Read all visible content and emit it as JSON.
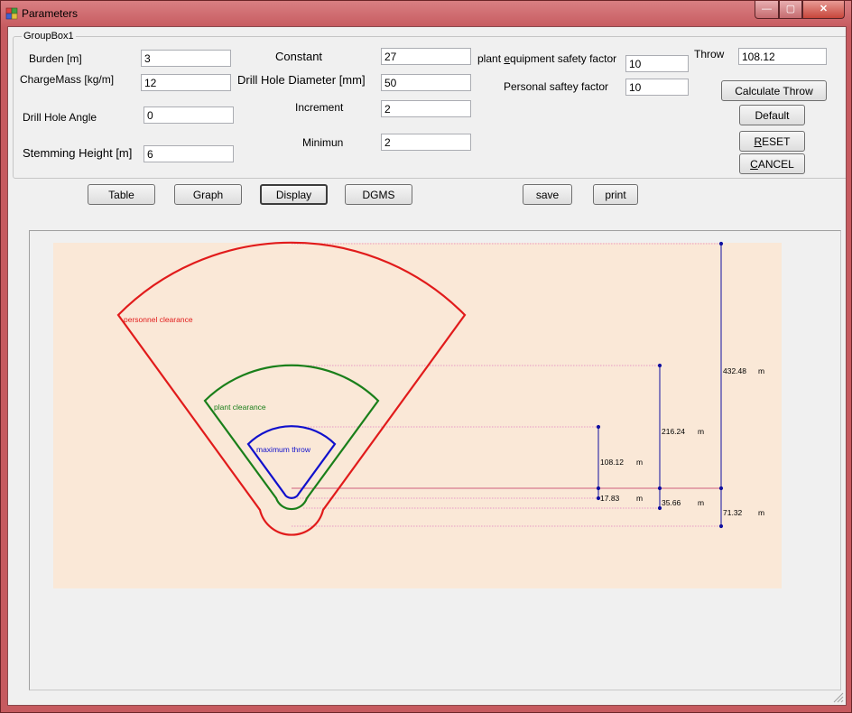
{
  "window": {
    "title": "Parameters",
    "controls": {
      "minimize": "—",
      "maximize": "▢",
      "close": "✕"
    }
  },
  "groupbox": {
    "title": "GroupBox1",
    "fields": {
      "burden": {
        "label": "Burden  [m]",
        "value": "3"
      },
      "charge_mass": {
        "label": "ChargeMass  [kg/m]",
        "value": "12"
      },
      "drill_hole_angle": {
        "label": "Drill Hole Angle",
        "value": "0"
      },
      "stemming_height": {
        "label": "Stemming Height [m]",
        "value": "6"
      },
      "constant": {
        "label": "Constant",
        "value": "27"
      },
      "drill_hole_diameter": {
        "label": "Drill Hole Diameter [mm]",
        "value": "50"
      },
      "increment": {
        "label": "Increment",
        "value": "2"
      },
      "minimum": {
        "label": "Minimun",
        "value": "2"
      },
      "plant_safety": {
        "label_pre": "plant ",
        "label_key": "e",
        "label_post": "quipment safety factor",
        "value": "10"
      },
      "personal_safety": {
        "label": "Personal saftey factor",
        "value": "10"
      },
      "throw": {
        "label": "Throw",
        "value": "108.12"
      }
    },
    "buttons": {
      "calculate": "Calculate Throw",
      "default": "Default",
      "reset_key": "R",
      "reset_rest": "ESET",
      "cancel_key": "C",
      "cancel_rest": "ANCEL"
    }
  },
  "toolbar": {
    "table": "Table",
    "graph": "Graph",
    "display": "Display",
    "dgms": "DGMS",
    "save": "save",
    "print": "print"
  },
  "diagram": {
    "colors": {
      "personnel": "#e11b1b",
      "plant": "#1a7f1a",
      "throw": "#1010cc",
      "background": "#fae8d7",
      "dim": "#1010a0",
      "guide": "#e080c0"
    },
    "labels": {
      "personnel": "personnel clearance",
      "plant": "plant clearance",
      "throw": "maximum throw"
    },
    "dimensions": {
      "throw_value": "108.12",
      "throw_base": "17.83",
      "plant_value": "216.24",
      "plant_base": "35.66",
      "personnel_value": "432.48",
      "personnel_base": "71.32",
      "unit": "m"
    }
  }
}
